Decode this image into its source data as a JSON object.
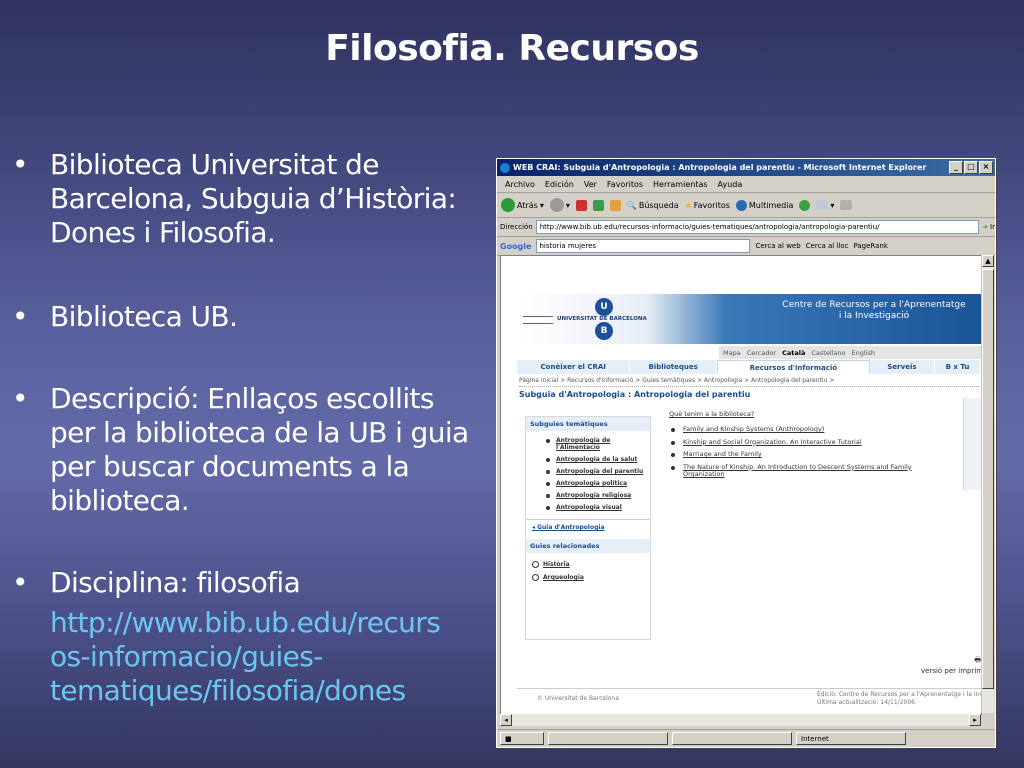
{
  "slide": {
    "title": "Filosofia. Recursos",
    "bullets": [
      "Biblioteca Universitat de Barcelona, Subguia d’Història: Dones i Filosofia.",
      "Biblioteca UB.",
      "Descripció: Enllaços escollits per la biblioteca de la UB i guia per buscar documents a la biblioteca.",
      "Disciplina: filosofia"
    ],
    "link": "http://www.bib.ub.edu/recursos-informacio/guies-tematiques/filosofia/dones",
    "bullet_char": "•"
  },
  "browser": {
    "window_title": "WEB CRAI: Subguia d'Antropologia : Antropologia del parentiu - Microsoft Internet Explorer",
    "menu": [
      "Archivo",
      "Edición",
      "Ver",
      "Favoritos",
      "Herramientas",
      "Ayuda"
    ],
    "toolbar": {
      "back": "Atrás",
      "search": "Búsqueda",
      "favorites": "Favoritos",
      "multimedia": "Multimedia"
    },
    "address_label": "Dirección",
    "address_value": "http://www.bib.ub.edu/recursos-informacio/guies-tematiques/antropologia/antropologia-parentiu/",
    "go_label": "Ir",
    "google_logo": "Google",
    "google_query": "historia mujeres",
    "google_web": "Cerca al web",
    "google_site": "Cerca al lloc",
    "pagerank": "PageRank",
    "status_internet": "Internet"
  },
  "page": {
    "ub_name": "UNIVERSITAT DE BARCELONA",
    "crai_title_1": "Centre de Recursos per a l'Aprenentatge",
    "crai_title_2": "i la Investigació",
    "lang_items": [
      "Mapa",
      "Cercador",
      "Català",
      "Castellano",
      "English"
    ],
    "nav": [
      "Conèixer el CRAI",
      "Biblioteques",
      "Recursos d'informació",
      "Serveis",
      "B x Tu"
    ],
    "breadcrumb": "Pàgina inicial > Recursos d'informació > Guies temàtiques > Antropologia > Antropologia del parentiu >",
    "subtitle": "Subguia d'Antropologia : Antropologia del parentiu",
    "subguides_head": "Subguies temàtiques",
    "subguides": [
      "Antropologia de l'Alimentació",
      "Antropologia de la salut",
      "Antropologia del parentiu",
      "Antropologia política",
      "Antropologia religiosa",
      "Antropologia visual"
    ],
    "guide_link": "Guia d'Antropologia",
    "related_head": "Guies relacionades",
    "related": [
      "Història",
      "Arqueologia"
    ],
    "question": "Què tenim a la biblioteca?",
    "resources": [
      "Family and Kinship Systems (Anthropology)",
      "Kinship and Social Organization. An Interactive Tutorial",
      "Marriage and the Family",
      "The Nature of Kinship. An Introduction to Descent Systems and Family Organization"
    ],
    "print": "versió per imprimir",
    "footer_left": "© Universitat de Barcelona",
    "footer_right_1": "Edició: Centre de Recursos per a l'Aprenentatge i la Investigació",
    "footer_right_2": "Última actualització: 14/11/2006"
  }
}
